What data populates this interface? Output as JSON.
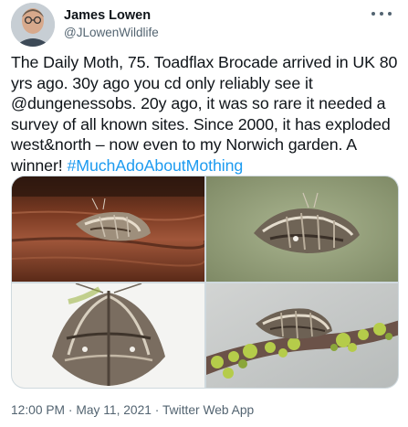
{
  "author": {
    "name": "James Lowen",
    "handle": "@JLowenWildlife"
  },
  "tweet": {
    "text": "The Daily Moth, 75. Toadflax Brocade arrived in UK 80 yrs ago. 30y ago you cd only reliably see it @dungenessobs. 20y ago, it was so rare it needed a survey of all known sites. Since 2000, it has exploded west&north – now even to my Norwich garden. A winner! ",
    "hashtag": "#MuchAdoAboutMothing"
  },
  "photos": [
    {
      "icon": "moth-on-wood-photo"
    },
    {
      "icon": "moth-on-green-photo"
    },
    {
      "icon": "moth-spread-wings-photo"
    },
    {
      "icon": "moth-on-lichen-twig-photo"
    }
  ],
  "meta": {
    "time": "12:00 PM",
    "separator": "·",
    "date": "May 11, 2021",
    "source": "Twitter Web App"
  },
  "colors": {
    "text": "#0f1419",
    "secondary": "#536471",
    "link": "#1d9bf0"
  }
}
